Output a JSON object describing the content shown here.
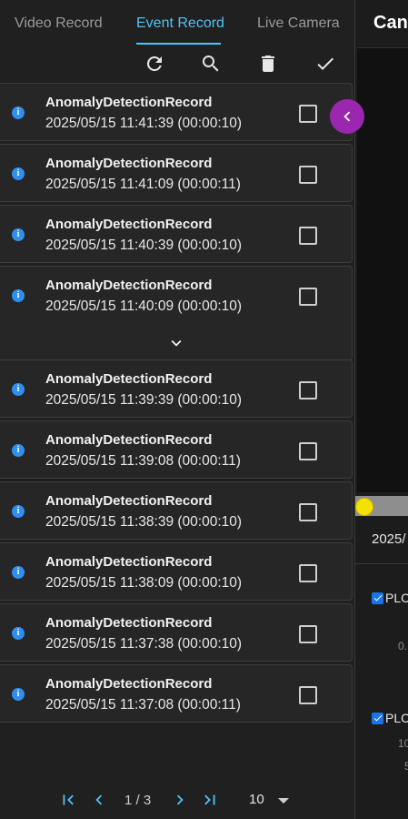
{
  "tabs": [
    {
      "label": "Video Record",
      "active": false
    },
    {
      "label": "Event Record",
      "active": true
    },
    {
      "label": "Live Camera",
      "active": false
    }
  ],
  "toolbar": {
    "refresh_icon": "refresh-icon",
    "search_icon": "search-icon",
    "delete_icon": "trash-icon",
    "confirm_icon": "check-icon"
  },
  "records": [
    {
      "title": "AnomalyDetectionRecord",
      "time": "2025/05/15 11:41:39 (00:00:10)"
    },
    {
      "title": "AnomalyDetectionRecord",
      "time": "2025/05/15 11:41:09 (00:00:11)"
    },
    {
      "title": "AnomalyDetectionRecord",
      "time": "2025/05/15 11:40:39 (00:00:10)"
    },
    {
      "title": "AnomalyDetectionRecord",
      "time": "2025/05/15 11:40:09 (00:00:10)"
    },
    {
      "title": "AnomalyDetectionRecord",
      "time": "2025/05/15 11:39:39 (00:00:10)"
    },
    {
      "title": "AnomalyDetectionRecord",
      "time": "2025/05/15 11:39:08 (00:00:11)"
    },
    {
      "title": "AnomalyDetectionRecord",
      "time": "2025/05/15 11:38:39 (00:00:10)"
    },
    {
      "title": "AnomalyDetectionRecord",
      "time": "2025/05/15 11:38:09 (00:00:10)"
    },
    {
      "title": "AnomalyDetectionRecord",
      "time": "2025/05/15 11:37:38 (00:00:10)"
    },
    {
      "title": "AnomalyDetectionRecord",
      "time": "2025/05/15 11:37:08 (00:00:11)"
    }
  ],
  "pagination": {
    "page_text": "1 / 3",
    "page_size": "10"
  },
  "right_panel": {
    "title": "Can",
    "date": "2025/",
    "plc_1": "PLC",
    "plc_2": "PLC",
    "num_1": "0.",
    "num_2": "10",
    "num_3": "5"
  },
  "colors": {
    "accent": "#4fc3f7",
    "info": "#2f8ff0",
    "collapse": "#9b27b0",
    "scrubber": "#f5e100"
  }
}
